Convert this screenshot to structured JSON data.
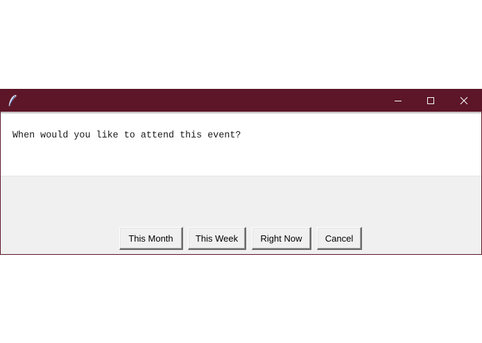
{
  "window": {
    "app_icon": "feather-icon",
    "controls": {
      "minimize_icon": "minimize-icon",
      "maximize_icon": "maximize-icon",
      "close_icon": "close-icon"
    },
    "colors": {
      "titlebar": "#5c1628",
      "body": "#f0f0f0"
    }
  },
  "dialog": {
    "message": "When would you like to attend this event?",
    "buttons": [
      {
        "label": "This Month"
      },
      {
        "label": "This Week"
      },
      {
        "label": "Right Now"
      },
      {
        "label": "Cancel"
      }
    ]
  }
}
